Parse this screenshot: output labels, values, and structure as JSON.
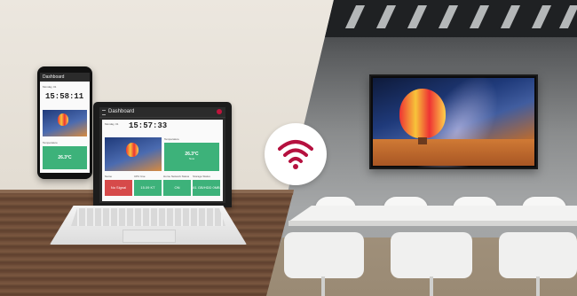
{
  "laptop": {
    "app_title": "Dashboard",
    "clock": "15:57:33",
    "date_label": "Monday, 01",
    "temperature_header": "Temperature",
    "temperature_value": "26.3°C",
    "temperature_sub": "Now",
    "row_labels": [
      "Name",
      "CPU Use",
      "Home Network Status",
      "Storage Status"
    ],
    "row_values": [
      "No Signal",
      "15.09 KT",
      "ON",
      "81 GB/HDD 0MB"
    ]
  },
  "phone": {
    "app_title": "Dashboard",
    "clock": "15:58:11",
    "date_label": "Monday, 01",
    "temperature_header": "Temperature",
    "temperature_value": "26.3°C"
  },
  "icons": {
    "wifi": "wifi-icon",
    "menu": "hamburger-menu-icon",
    "brand": "brand-logo-icon"
  },
  "colors": {
    "wifi_accent": "#b5113f",
    "tile_green": "#3db27a",
    "tile_red": "#d64a4a"
  }
}
